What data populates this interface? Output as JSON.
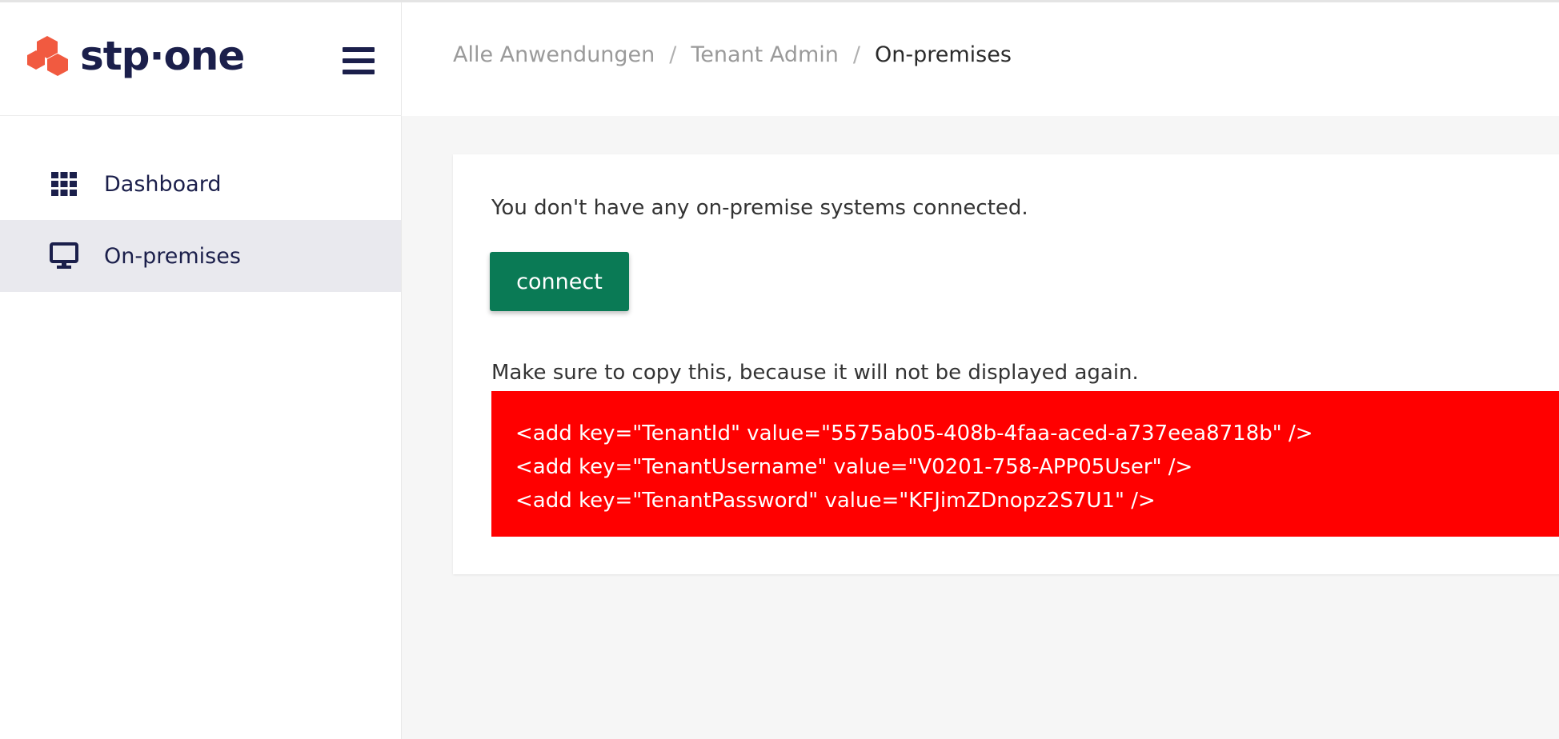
{
  "brand": {
    "logo_text": "stp·one",
    "logo_color": "#f15a40",
    "text_color": "#1b1f4b"
  },
  "header": {
    "breadcrumb": [
      {
        "label": "Alle Anwendungen"
      },
      {
        "label": "Tenant Admin"
      },
      {
        "label": "On-premises"
      }
    ],
    "separator": "/"
  },
  "sidebar": {
    "items": [
      {
        "label": "Dashboard",
        "icon": "grid-icon",
        "active": false
      },
      {
        "label": "On-premises",
        "icon": "monitor-icon",
        "active": true
      }
    ]
  },
  "main": {
    "message": "You don't have any on-premise systems connected.",
    "connect_label": "connect",
    "connect_color": "#0a7a55",
    "warning": "Make sure to copy this, because it will not be displayed again.",
    "config_bg": "#ff0000",
    "config_lines": [
      "<add key=\"TenantId\" value=\"5575ab05-408b-4faa-aced-a737eea8718b\" />",
      "<add key=\"TenantUsername\" value=\"V0201-758-APP05User\" />",
      "<add key=\"TenantPassword\" value=\"KFJimZDnopz2S7U1\" />"
    ]
  }
}
